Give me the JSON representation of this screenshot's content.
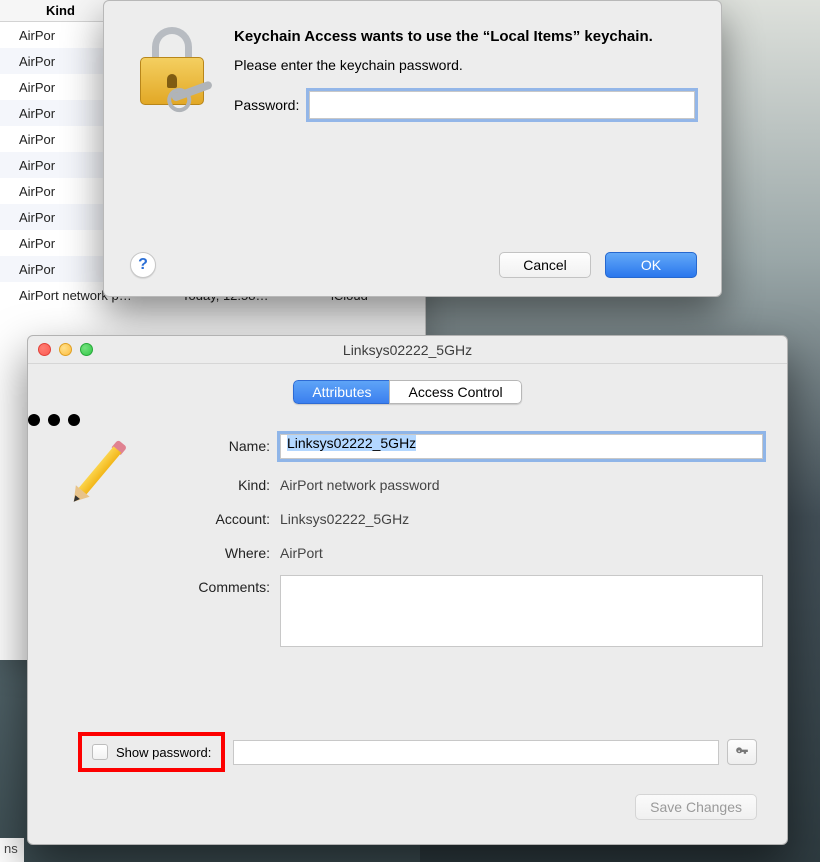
{
  "bg_list": {
    "header": "Kind",
    "rows": [
      {
        "col1": "AirPor"
      },
      {
        "col1": "AirPor"
      },
      {
        "col1": "AirPor"
      },
      {
        "col1": "AirPor"
      },
      {
        "col1": "AirPor"
      },
      {
        "col1": "AirPor"
      },
      {
        "col1": "AirPor"
      },
      {
        "col1": "AirPor"
      },
      {
        "col1": "AirPor"
      },
      {
        "col1": "AirPor"
      },
      {
        "col1": "AirPort network p…",
        "col2": "Today, 12:58…",
        "col3": "iCloud"
      }
    ],
    "partial": "ns"
  },
  "alert": {
    "heading": "Keychain Access wants to use the “Local Items” keychain.",
    "subtext": "Please enter the keychain password.",
    "password_label": "Password:",
    "password_value": "",
    "help_glyph": "?",
    "cancel": "Cancel",
    "ok": "OK"
  },
  "info": {
    "title": "Linksys02222_5GHz",
    "tabs": {
      "attributes": "Attributes",
      "access": "Access Control"
    },
    "labels": {
      "name": "Name:",
      "kind": "Kind:",
      "account": "Account:",
      "where": "Where:",
      "comments": "Comments:",
      "show_password": "Show password:"
    },
    "values": {
      "name": "Linksys02222_5GHz",
      "kind": "AirPort network password",
      "account": "Linksys02222_5GHz",
      "where": "AirPort",
      "comments": "",
      "password": ""
    },
    "save": "Save Changes"
  }
}
